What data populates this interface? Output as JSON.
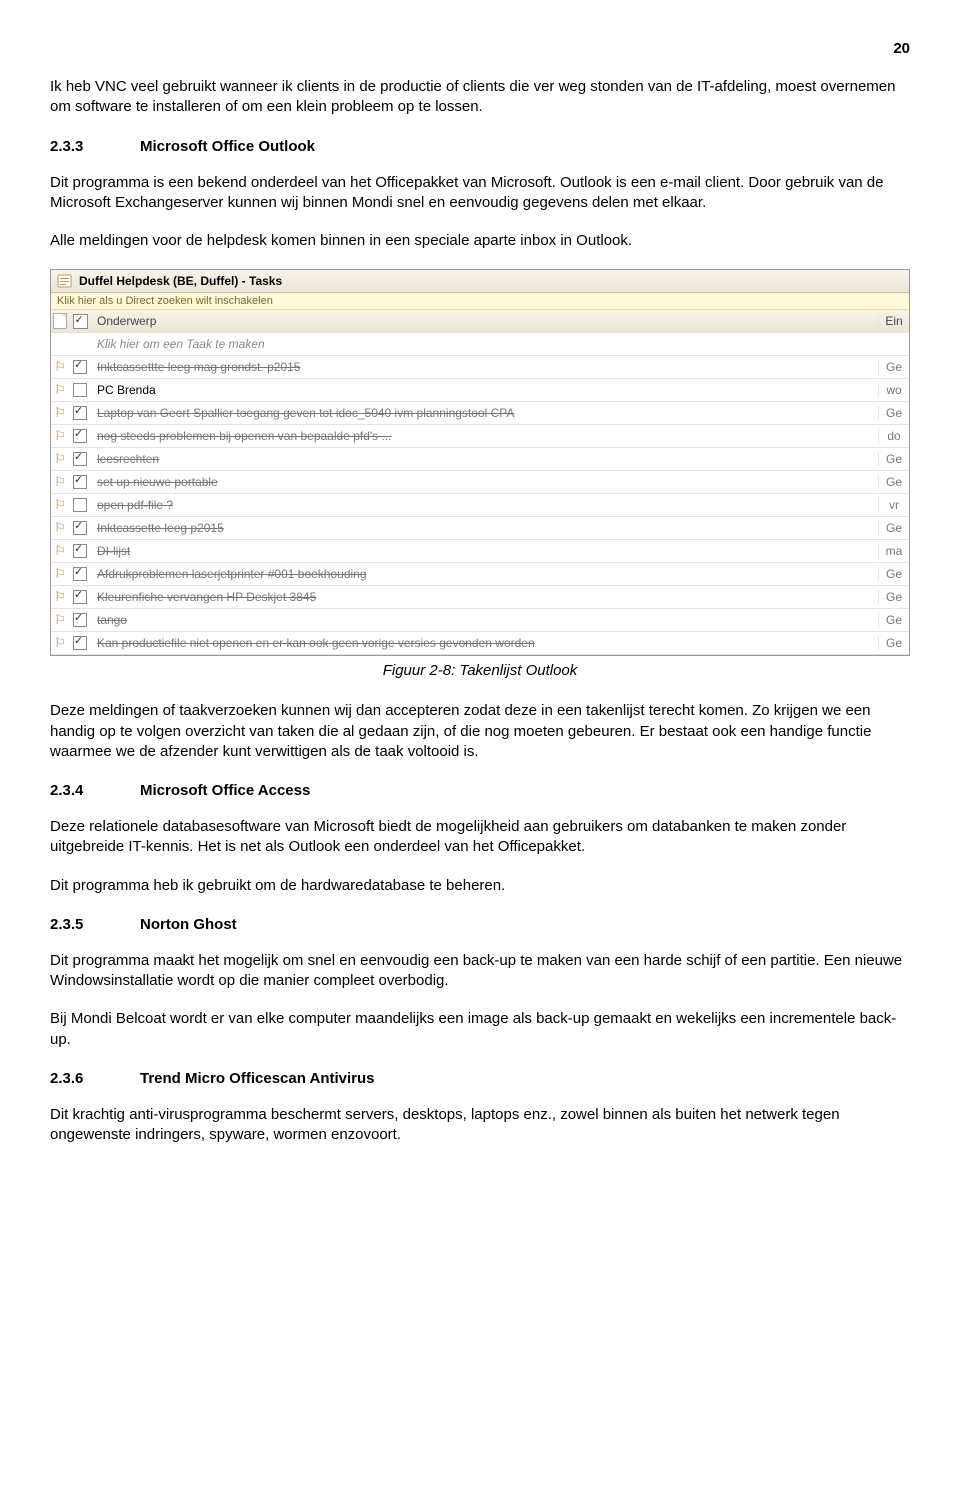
{
  "page_number": "20",
  "para1": "Ik heb VNC veel gebruikt wanneer ik clients in de productie of clients die ver weg stonden van de IT-afdeling, moest overnemen om software te installeren of om een klein probleem op te lossen.",
  "section_233": {
    "num": "2.3.3",
    "title": "Microsoft Office Outlook"
  },
  "para2": "Dit programma is een bekend onderdeel van het Officepakket van Microsoft. Outlook is een e-mail client. Door gebruik van de Microsoft Exchangeserver kunnen wij binnen Mondi snel en eenvoudig gegevens delen met elkaar.",
  "para3": "Alle meldingen voor de helpdesk komen binnen in een speciale aparte inbox in Outlook.",
  "outlook": {
    "title": "Duffel Helpdesk (BE, Duffel) - Tasks",
    "infobar": "Klik hier als u Direct zoeken wilt inschakelen",
    "header_subject": "Onderwerp",
    "header_end": "Ein",
    "new_task_hint": "Klik hier om een Taak te maken",
    "tasks": [
      {
        "done": true,
        "checked": true,
        "subject": "Inktcassettte leeg mag grondst. p2015",
        "end": "Ge"
      },
      {
        "done": false,
        "checked": false,
        "subject": "PC Brenda",
        "end": "wo"
      },
      {
        "done": true,
        "checked": true,
        "subject": "Laptop van Geert Spallier toegang geven tot idoc_5040 ivm planningstool CPA",
        "end": "Ge"
      },
      {
        "done": true,
        "checked": true,
        "subject": "nog steeds problemen bij openen van bepaalde pfd's ...",
        "end": "do"
      },
      {
        "done": true,
        "checked": true,
        "subject": "leesrechten",
        "end": "Ge"
      },
      {
        "done": true,
        "checked": true,
        "subject": "set up nieuwe portable",
        "end": "Ge"
      },
      {
        "done": true,
        "checked": false,
        "subject": "open pdf-file ?",
        "end": "vr"
      },
      {
        "done": true,
        "checked": true,
        "subject": "Inktcassette leeg p2015",
        "end": "Ge"
      },
      {
        "done": true,
        "checked": true,
        "subject": "DI-lijst",
        "end": "ma"
      },
      {
        "done": true,
        "checked": true,
        "subject": "Afdrukproblemen laserjetprinter #001  boekhouding",
        "end": "Ge"
      },
      {
        "done": true,
        "checked": true,
        "subject": "Kleurenfiche vervangen HP Deskjet 3845",
        "end": "Ge"
      },
      {
        "done": true,
        "checked": true,
        "subject": "tango",
        "end": "Ge"
      },
      {
        "done": true,
        "checked": true,
        "subject": "Kan productiefile niet openen en er kan ook geen vorige versies gevonden worden",
        "end": "Ge"
      }
    ]
  },
  "figure_caption": "Figuur 2-8: Takenlijst Outlook",
  "para4": "Deze meldingen of taakverzoeken kunnen wij dan accepteren zodat deze in een takenlijst terecht komen. Zo krijgen we een handig op te volgen overzicht van taken die al gedaan zijn, of die nog moeten gebeuren. Er bestaat ook een handige functie waarmee we de afzender kunt verwittigen als de taak voltooid is.",
  "section_234": {
    "num": "2.3.4",
    "title": "Microsoft Office Access"
  },
  "para5": "Deze relationele databasesoftware van Microsoft biedt de mogelijkheid aan gebruikers om databanken te maken zonder uitgebreide IT-kennis. Het is net als Outlook een onderdeel van het Officepakket.",
  "para6": "Dit programma heb ik gebruikt om de hardwaredatabase te beheren.",
  "section_235": {
    "num": "2.3.5",
    "title": "Norton Ghost"
  },
  "para7": "Dit programma maakt het mogelijk om snel en eenvoudig een back-up te maken van een harde schijf of een partitie. Een nieuwe Windowsinstallatie wordt op die manier compleet overbodig.",
  "para8": "Bij Mondi Belcoat wordt er van elke computer maandelijks een image als back-up gemaakt en wekelijks een incrementele back-up.",
  "section_236": {
    "num": "2.3.6",
    "title": "Trend Micro Officescan Antivirus"
  },
  "para9": "Dit krachtig anti-virusprogramma beschermt servers, desktops, laptops enz., zowel binnen als buiten het netwerk tegen ongewenste indringers, spyware, wormen enzovoort."
}
